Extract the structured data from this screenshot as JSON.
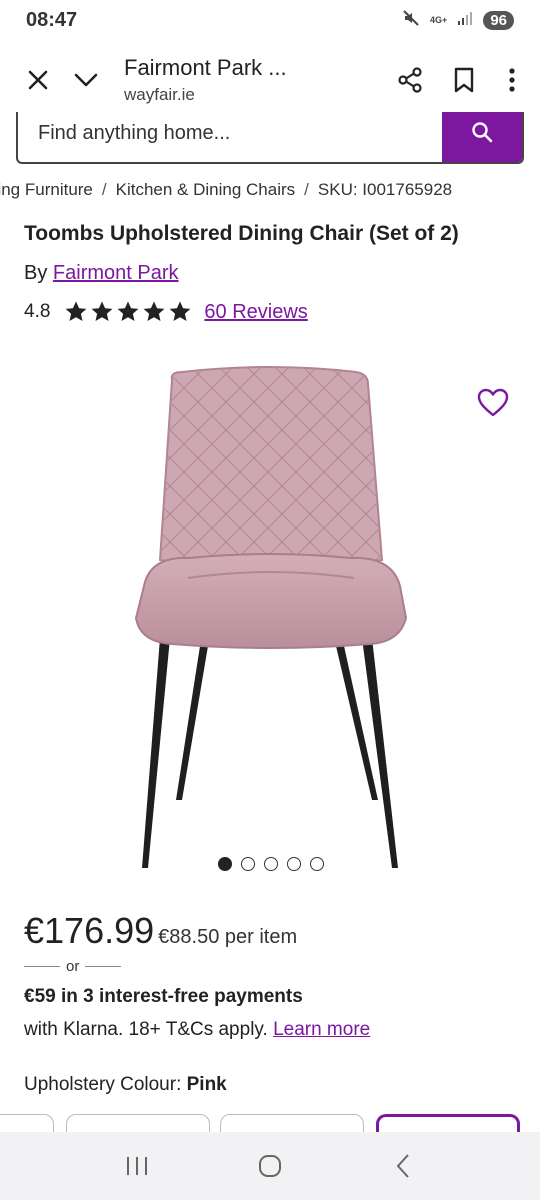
{
  "status": {
    "time": "08:47",
    "network": "4G+",
    "battery": "96"
  },
  "browser": {
    "title": "Fairmont Park ...",
    "url": "wayfair.ie"
  },
  "search": {
    "placeholder": "Find anything home..."
  },
  "breadcrumb": [
    "ning Furniture",
    "Kitchen & Dining Chairs",
    "SKU: I001765928"
  ],
  "product": {
    "title": "Toombs Upholstered Dining Chair (Set of 2)",
    "by_label": "By",
    "brand": "Fairmont Park",
    "rating": "4.8",
    "stars": 5,
    "reviews": "60 Reviews",
    "image_count": 5,
    "active_image": 1
  },
  "pricing": {
    "price": "€176.99",
    "per_item": "€88.50 per item",
    "or": "or",
    "klarna_line1": "€59 in 3 interest-free payments",
    "klarna_line2": "with Klarna. 18+ T&Cs apply.",
    "learn_more": "Learn more"
  },
  "options": {
    "label": "Upholstery Colour:",
    "value": "Pink",
    "swatch_count": 4,
    "selected_swatch": 4
  },
  "colors": {
    "accent": "#7b189f",
    "chair": "#c9a2ad",
    "legs": "#1f1f1f"
  }
}
